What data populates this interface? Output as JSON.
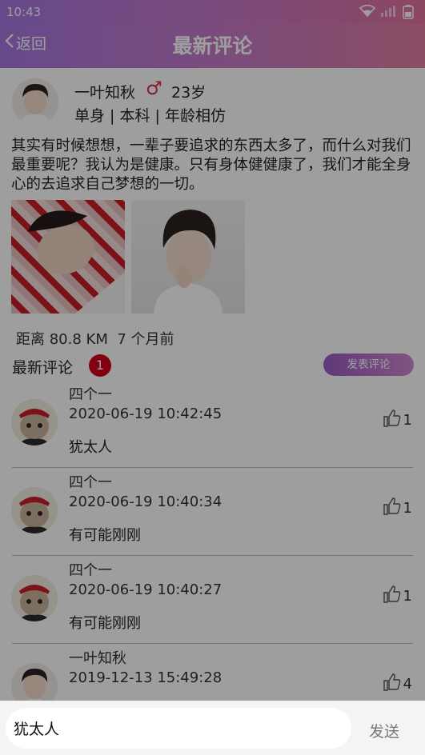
{
  "status": {
    "time": "10:43"
  },
  "header": {
    "back_label": "返回",
    "title": "最新评论"
  },
  "post": {
    "name": "一叶知秋",
    "gender_symbol": "♂",
    "age": "23岁",
    "tags": "单身 | 本科 | 年龄相仿",
    "text": "其实有时候想想，一辈子要追求的东西太多了，而什么对我们最重要呢？我认为是健康。只有身体健健康了，我们才能全身心的去追求自己梦想的一切。",
    "distance": "距离 80.8 KM",
    "posted": "7 个月前"
  },
  "comments_section": {
    "label": "最新评论",
    "badge": "1",
    "post_button": "发表评论"
  },
  "comments": [
    {
      "name": "四个一",
      "time": "2020-06-19 10:42:45",
      "text": "犹太人",
      "likes": "1"
    },
    {
      "name": "四个一",
      "time": "2020-06-19 10:40:34",
      "text": "有可能刚刚",
      "likes": "1"
    },
    {
      "name": "四个一",
      "time": "2020-06-19 10:40:27",
      "text": "有可能刚刚",
      "likes": "1"
    },
    {
      "name": "一叶知秋",
      "time": "2019-12-13 15:49:28",
      "text": "",
      "likes": "4"
    }
  ],
  "input": {
    "value": "犹太人",
    "send_label": "发送"
  }
}
